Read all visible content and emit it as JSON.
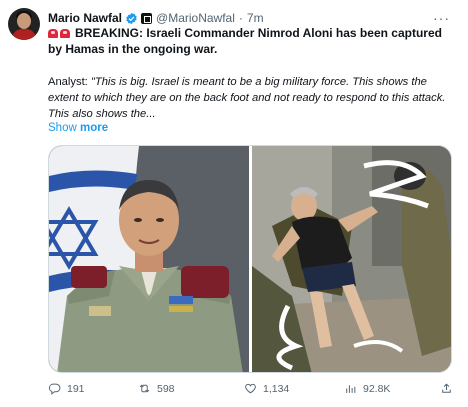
{
  "author": {
    "name": "Mario Nawfal",
    "handle": "@MarioNawfal",
    "separator": "·",
    "time": "7m",
    "verified_color": "#1d9bf0"
  },
  "tweet": {
    "headline_line1": "BREAKING: Israeli Commander Nimrod Aloni has been captured",
    "headline_line2": "by Hamas in the ongoing war.",
    "analyst_label": "Analyst: ",
    "analyst_quote": "\"This is big. Israel is meant to be a big military force. This shows the extent to which they are on the back foot and not ready to respond to this attack. This also shows the...",
    "show_label": "Show",
    "more_label": "more"
  },
  "media": {
    "left_image": "officer-portrait-photo",
    "right_image": "captured-man-photo"
  },
  "stats": {
    "replies": "191",
    "retweets": "598",
    "likes": "1,134",
    "views": "92.8K"
  },
  "icons": {
    "more": "more-options-icon",
    "reply": "reply-icon",
    "retweet": "retweet-icon",
    "like": "heart-icon",
    "views": "views-icon",
    "share": "share-icon",
    "siren": "siren-emoji-icon"
  },
  "colors": {
    "link": "#1d9bf0",
    "secondary_text": "#536471",
    "text": "#0f1419"
  }
}
